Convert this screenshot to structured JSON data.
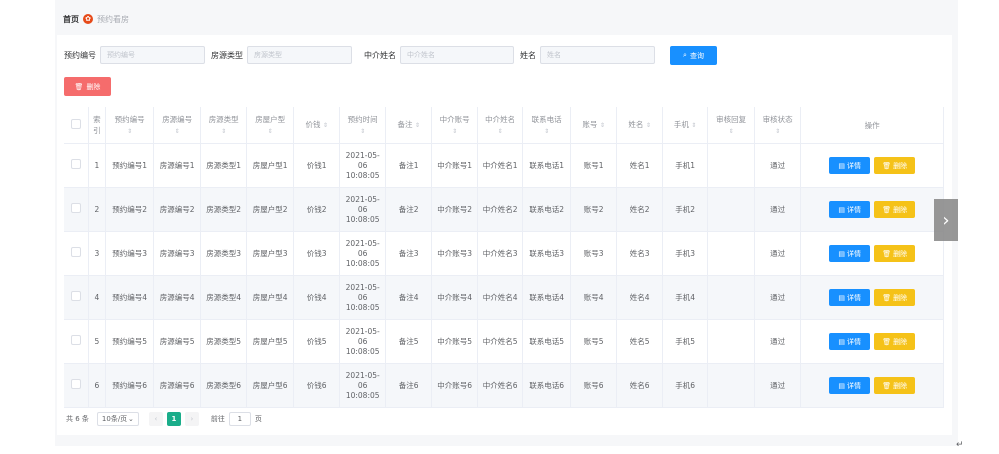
{
  "breadcrumb": {
    "home": "首页",
    "current": "预约看房"
  },
  "search": [
    {
      "label": "预约编号",
      "placeholder": "预约编号"
    },
    {
      "label": "房源类型",
      "placeholder": "房源类型"
    },
    {
      "label": "中介姓名",
      "placeholder": "中介姓名"
    },
    {
      "label": "姓名",
      "placeholder": "姓名"
    }
  ],
  "search_button": "查询",
  "delete_button": "删除",
  "table": {
    "headers": [
      "索引",
      "预约编号",
      "房源编号",
      "房源类型",
      "房屋户型",
      "价钱",
      "预约时间",
      "备注",
      "中介账号",
      "中介姓名",
      "联系电话",
      "账号",
      "姓名",
      "手机",
      "审核回复",
      "审核状态",
      "操作"
    ],
    "rows": [
      {
        "index": "1",
        "booking": "预约编号1",
        "house": "房源编号1",
        "type": "房源类型1",
        "layout": "房屋户型1",
        "price": "价钱1",
        "time": "2021-05-06 10:08:05",
        "note": "备注1",
        "agent_acct": "中介账号1",
        "agent_name": "中介姓名1",
        "phone": "联系电话1",
        "acct": "账号1",
        "name": "姓名1",
        "mobile": "手机1",
        "reply": "",
        "status": "通过"
      },
      {
        "index": "2",
        "booking": "预约编号2",
        "house": "房源编号2",
        "type": "房源类型2",
        "layout": "房屋户型2",
        "price": "价钱2",
        "time": "2021-05-06 10:08:05",
        "note": "备注2",
        "agent_acct": "中介账号2",
        "agent_name": "中介姓名2",
        "phone": "联系电话2",
        "acct": "账号2",
        "name": "姓名2",
        "mobile": "手机2",
        "reply": "",
        "status": "通过"
      },
      {
        "index": "3",
        "booking": "预约编号3",
        "house": "房源编号3",
        "type": "房源类型3",
        "layout": "房屋户型3",
        "price": "价钱3",
        "time": "2021-05-06 10:08:05",
        "note": "备注3",
        "agent_acct": "中介账号3",
        "agent_name": "中介姓名3",
        "phone": "联系电话3",
        "acct": "账号3",
        "name": "姓名3",
        "mobile": "手机3",
        "reply": "",
        "status": "通过"
      },
      {
        "index": "4",
        "booking": "预约编号4",
        "house": "房源编号4",
        "type": "房源类型4",
        "layout": "房屋户型4",
        "price": "价钱4",
        "time": "2021-05-06 10:08:05",
        "note": "备注4",
        "agent_acct": "中介账号4",
        "agent_name": "中介姓名4",
        "phone": "联系电话4",
        "acct": "账号4",
        "name": "姓名4",
        "mobile": "手机4",
        "reply": "",
        "status": "通过"
      },
      {
        "index": "5",
        "booking": "预约编号5",
        "house": "房源编号5",
        "type": "房源类型5",
        "layout": "房屋户型5",
        "price": "价钱5",
        "time": "2021-05-06 10:08:05",
        "note": "备注5",
        "agent_acct": "中介账号5",
        "agent_name": "中介姓名5",
        "phone": "联系电话5",
        "acct": "账号5",
        "name": "姓名5",
        "mobile": "手机5",
        "reply": "",
        "status": "通过"
      },
      {
        "index": "6",
        "booking": "预约编号6",
        "house": "房源编号6",
        "type": "房源类型6",
        "layout": "房屋户型6",
        "price": "价钱6",
        "time": "2021-05-06 10:08:05",
        "note": "备注6",
        "agent_acct": "中介账号6",
        "agent_name": "中介姓名6",
        "phone": "联系电话6",
        "acct": "账号6",
        "name": "姓名6",
        "mobile": "手机6",
        "reply": "",
        "status": "通过"
      }
    ],
    "detail_label": "详情",
    "delete_label": "删除"
  },
  "pagination": {
    "total": "共 6 条",
    "page_size": "10条/页",
    "current_page": "1",
    "goto_label": "前往",
    "goto_value": "1",
    "page_suffix": "页"
  },
  "icons": {
    "breadcrumb": "logo-icon",
    "search": "search-icon",
    "delete": "trash-icon",
    "detail": "document-icon",
    "next": "chevron-right-icon"
  },
  "colors": {
    "primary": "#1890ff",
    "danger": "#f56c6c",
    "warning": "#f5c218",
    "page_active": "#1aad8a"
  }
}
